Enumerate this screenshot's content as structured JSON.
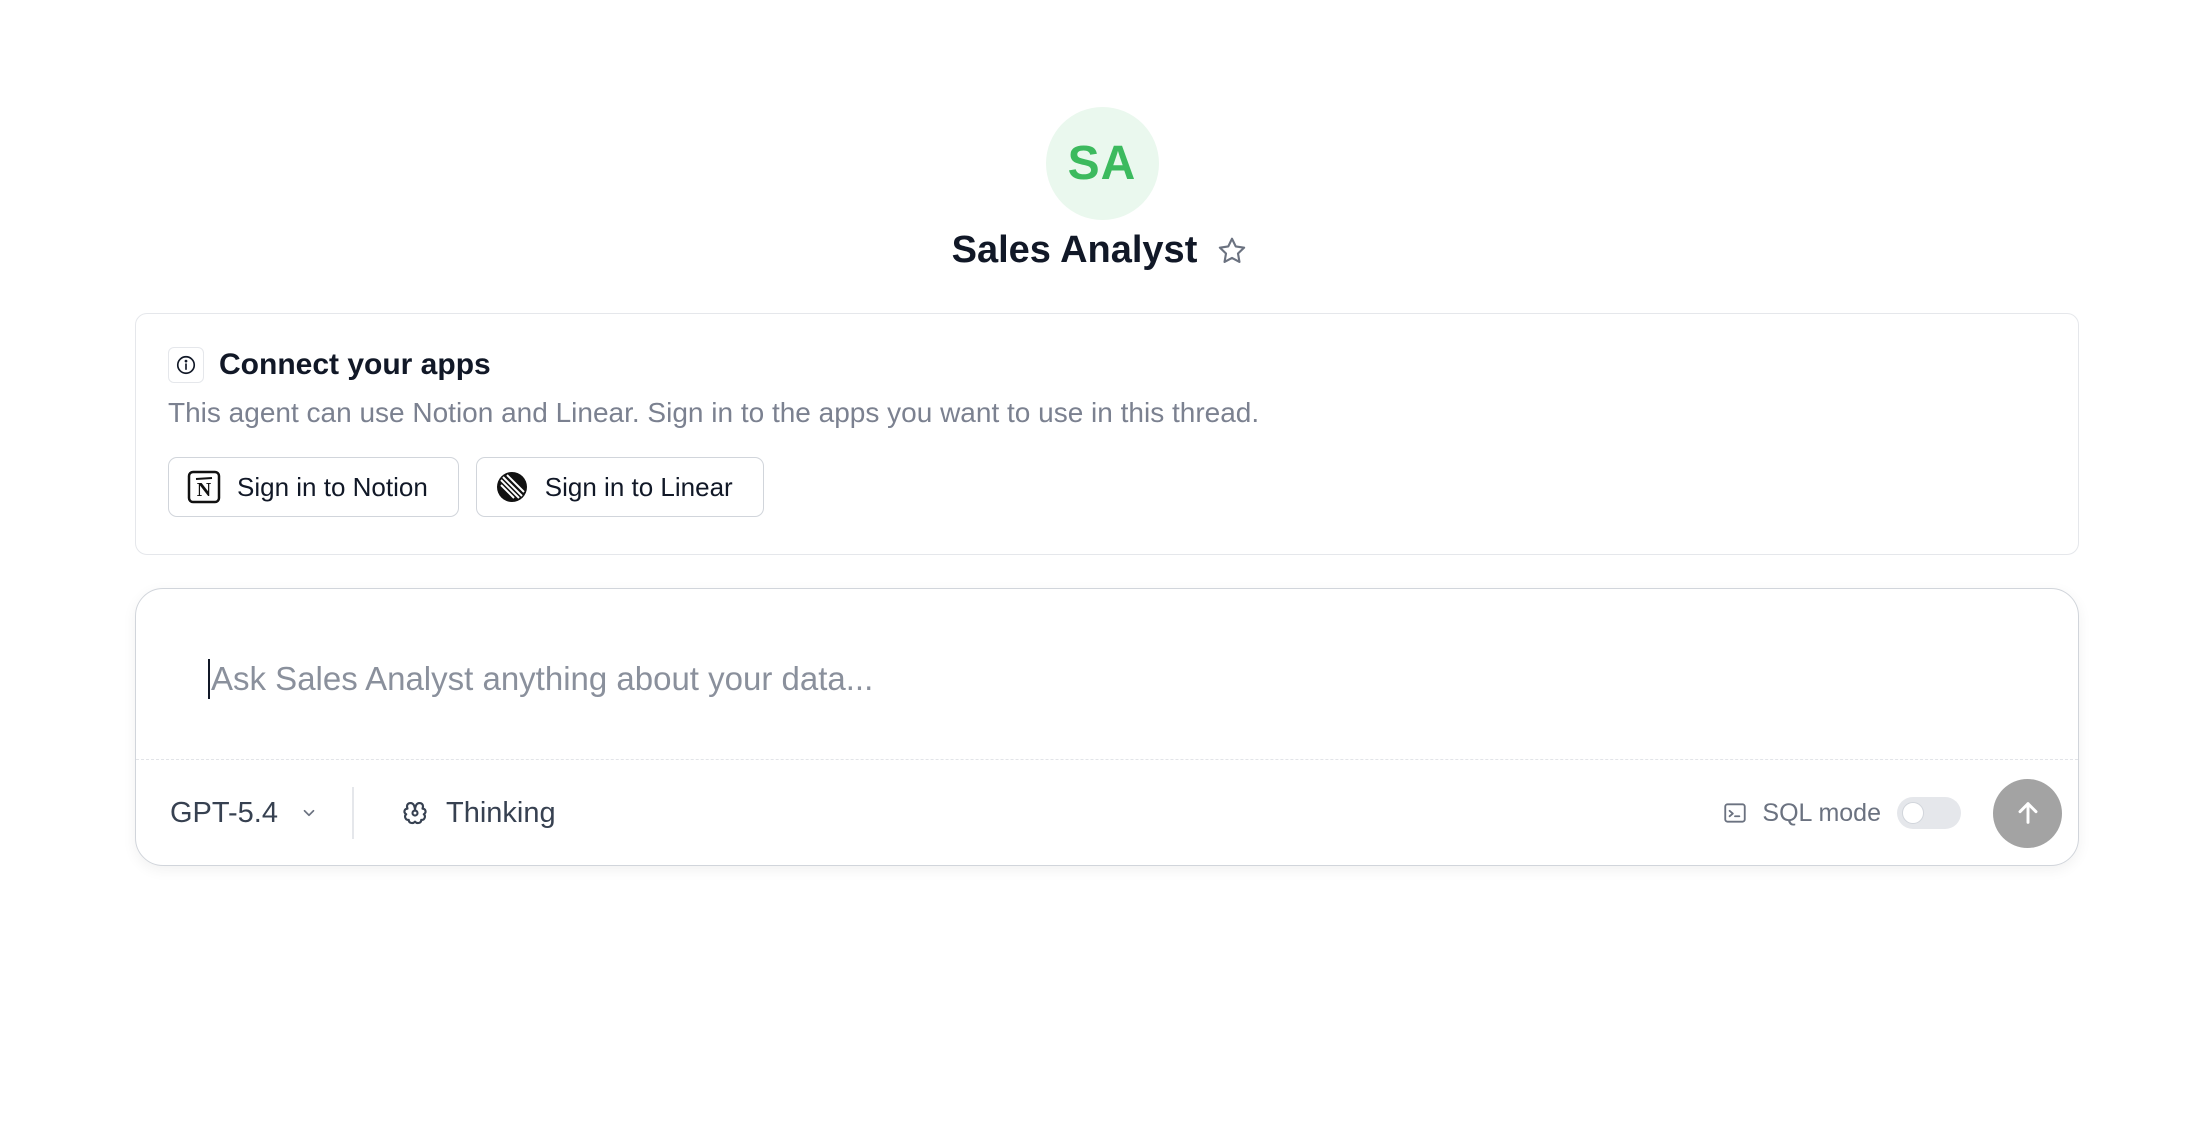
{
  "agent": {
    "initials": "SA",
    "name": "Sales Analyst",
    "avatar_bg": "#eaf8ee",
    "avatar_fg": "#3cba5e",
    "favorite_icon": "star-icon"
  },
  "connect": {
    "icon": "info-icon",
    "title": "Connect your apps",
    "description": "This agent can use Notion and Linear. Sign in to the apps you want to use in this thread.",
    "buttons": [
      {
        "label": "Sign in to Notion",
        "icon": "notion-icon"
      },
      {
        "label": "Sign in to Linear",
        "icon": "linear-icon"
      }
    ]
  },
  "composer": {
    "placeholder": "Ask Sales Analyst anything about your data...",
    "model": "GPT-5.4",
    "model_icon": "chevron-down-icon",
    "thinking_label": "Thinking",
    "thinking_icon": "brain-icon",
    "sql_mode_label": "SQL mode",
    "sql_mode_icon": "terminal-icon",
    "sql_mode_enabled": false,
    "send_icon": "arrow-up-icon",
    "send_color": "#a3a3a3"
  }
}
